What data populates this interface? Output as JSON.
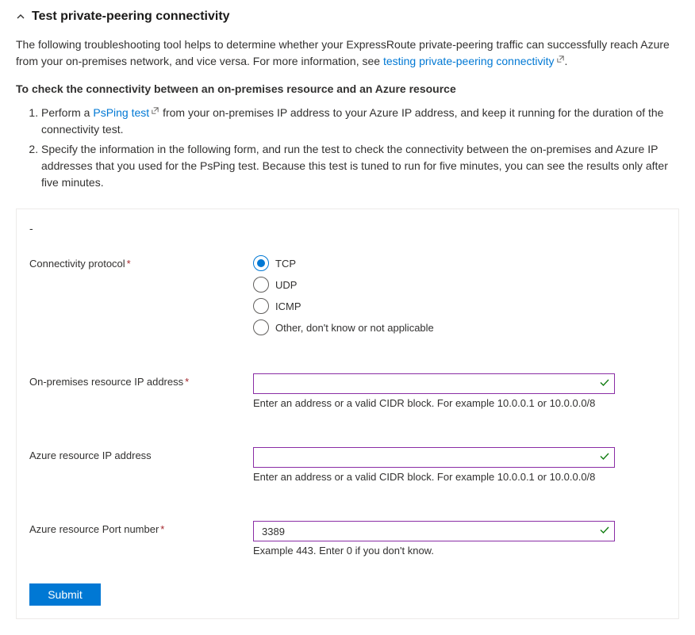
{
  "header": {
    "title": "Test private-peering connectivity"
  },
  "intro": {
    "text_before_link": "The following troubleshooting tool helps to determine whether your ExpressRoute private-peering traffic can successfully reach Azure from your on-premises network, and vice versa. For more information, see ",
    "link_text": "testing private-peering connectivity",
    "text_after_link": "."
  },
  "subheading": "To check the connectivity between an on-premises resource and an Azure resource",
  "steps": {
    "s1_before": "Perform a ",
    "s1_link": "PsPing test",
    "s1_after": " from your on-premises IP address to your Azure IP address, and keep it running for the duration of the connectivity test.",
    "s2": "Specify the information in the following form, and run the test to check the connectivity between the on-premises and Azure IP addresses that you used for the PsPing test. Because this test is tuned to run for five minutes, you can see the results only after five minutes."
  },
  "panel_dash": "-",
  "form": {
    "protocol": {
      "label": "Connectivity protocol",
      "required": true,
      "options": [
        "TCP",
        "UDP",
        "ICMP",
        "Other, don't know or not applicable"
      ],
      "selected": "TCP"
    },
    "onprem_ip": {
      "label": "On-premises resource IP address",
      "required": true,
      "value": "",
      "hint": "Enter an address or a valid CIDR block. For example 10.0.0.1 or 10.0.0.0/8"
    },
    "azure_ip": {
      "label": "Azure resource IP address",
      "required": false,
      "value": "",
      "hint": "Enter an address or a valid CIDR block. For example 10.0.0.1 or 10.0.0.0/8"
    },
    "azure_port": {
      "label": "Azure resource Port number",
      "required": true,
      "value": "3389",
      "hint": "Example 443. Enter 0 if you don't know."
    }
  },
  "submit_label": "Submit",
  "required_mark": "*"
}
